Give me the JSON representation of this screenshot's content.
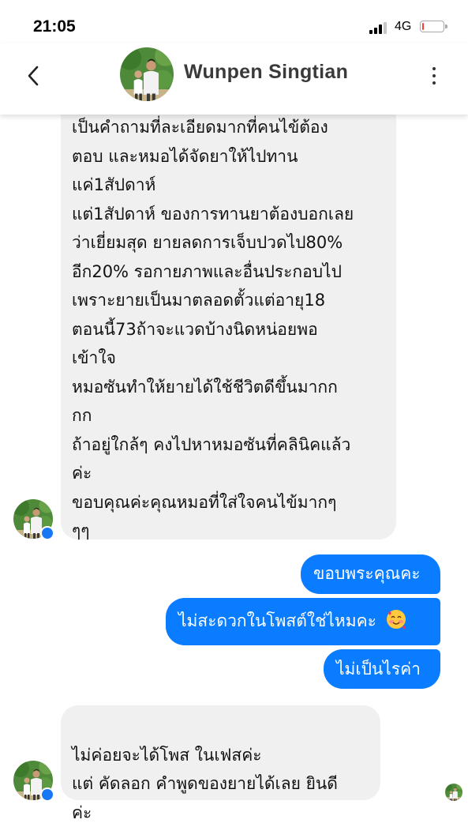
{
  "status_bar": {
    "time": "21:05",
    "network": "4G",
    "battery_level": 0.08,
    "signal_bars": 3
  },
  "header": {
    "contact_name": "Wunpen Singtian",
    "icons": {
      "back": "chevron-left-icon",
      "more": "more-vertical-icon"
    }
  },
  "messages": {
    "incoming_1": "เป็นคำถามที่ละเอียดมากที่คนไข้ต้อง\nตอบ และหมอได้จัดยาให้ไปทาน\nแค่1สัปดาห์\nแต่1สัปดาห์ ของการทานยาต้องบอกเลย\nว่าเยี่ยมสุด ยายลดการเจ็บปวดไป80%\nอีก20% รอกายภาพและอื่นประกอบไป\nเพราะยายเป็นมาตลอดตั้วแต่อายุ18\nตอนนี้73ถ้าจะแวดบ้างนิดหน่อยพอ\nเข้าใจ\nหมอซันทำให้ยายได้ใช้ชีวิตดีขึ้นมากก\nกก\nถ้าอยู่ใกล้ๆ คงไปหาหมอซันที่คลินิคแล้ว\nค่ะ\nขอบคุณค่ะคุณหมอที่ใส่ใจคนไข้มากๆ\nๆๆ",
    "outgoing_1": "ขอบพระคุณคะ",
    "outgoing_2": "ไม่สะดวกในโพสต์ใช่ไหมคะ",
    "outgoing_2_emoji": "smiling-face-with-hearts-emoji",
    "outgoing_3": "ไม่เป็นไรค่า",
    "incoming_2": "ไม่ค่อยจะได้โพส ในเฟสค่ะ\nแต่ คัดลอก คำพูดของยายได้เลย ยินดี\nค่ะ"
  },
  "colors": {
    "outgoing_bubble": "#0a7cff",
    "incoming_bubble": "#f0f0f0",
    "messenger_badge": "#1877f2"
  }
}
